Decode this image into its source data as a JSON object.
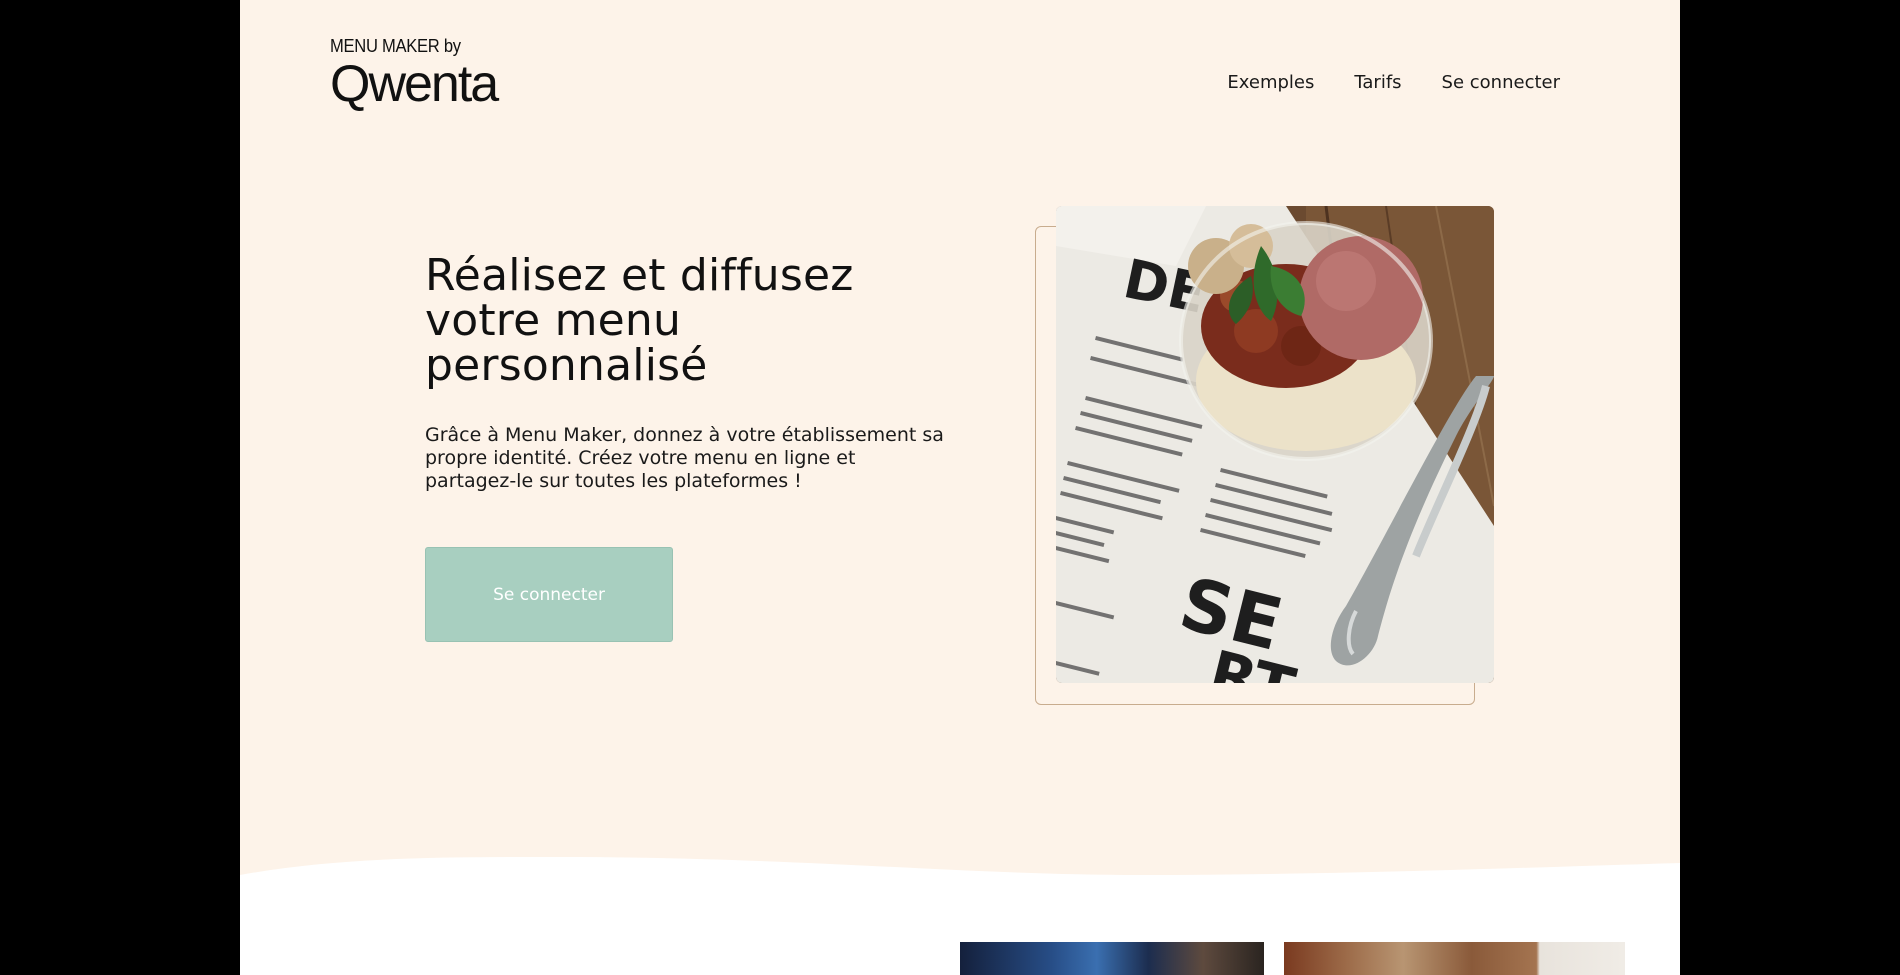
{
  "brand": {
    "tagline": "MENU MAKER by",
    "name": "Qwenta"
  },
  "nav": {
    "items": [
      {
        "label": "Exemples"
      },
      {
        "label": "Tarifs"
      },
      {
        "label": "Se connecter"
      }
    ]
  },
  "hero": {
    "title": "Réalisez et diffusez votre menu personnalisé",
    "description": "Grâce à Menu Maker, donnez à votre établissement sa propre identité. Créez votre menu en ligne et partagez-le sur toutes les plateformes !",
    "cta_label": "Se connecter"
  },
  "colors": {
    "page_background": "#fdf3e9",
    "cta_background": "#a8cfc0",
    "frame_border": "#c8ac8e",
    "outer_background": "#000000"
  },
  "icons": {
    "hero_image": "dessert-menu-photo"
  }
}
